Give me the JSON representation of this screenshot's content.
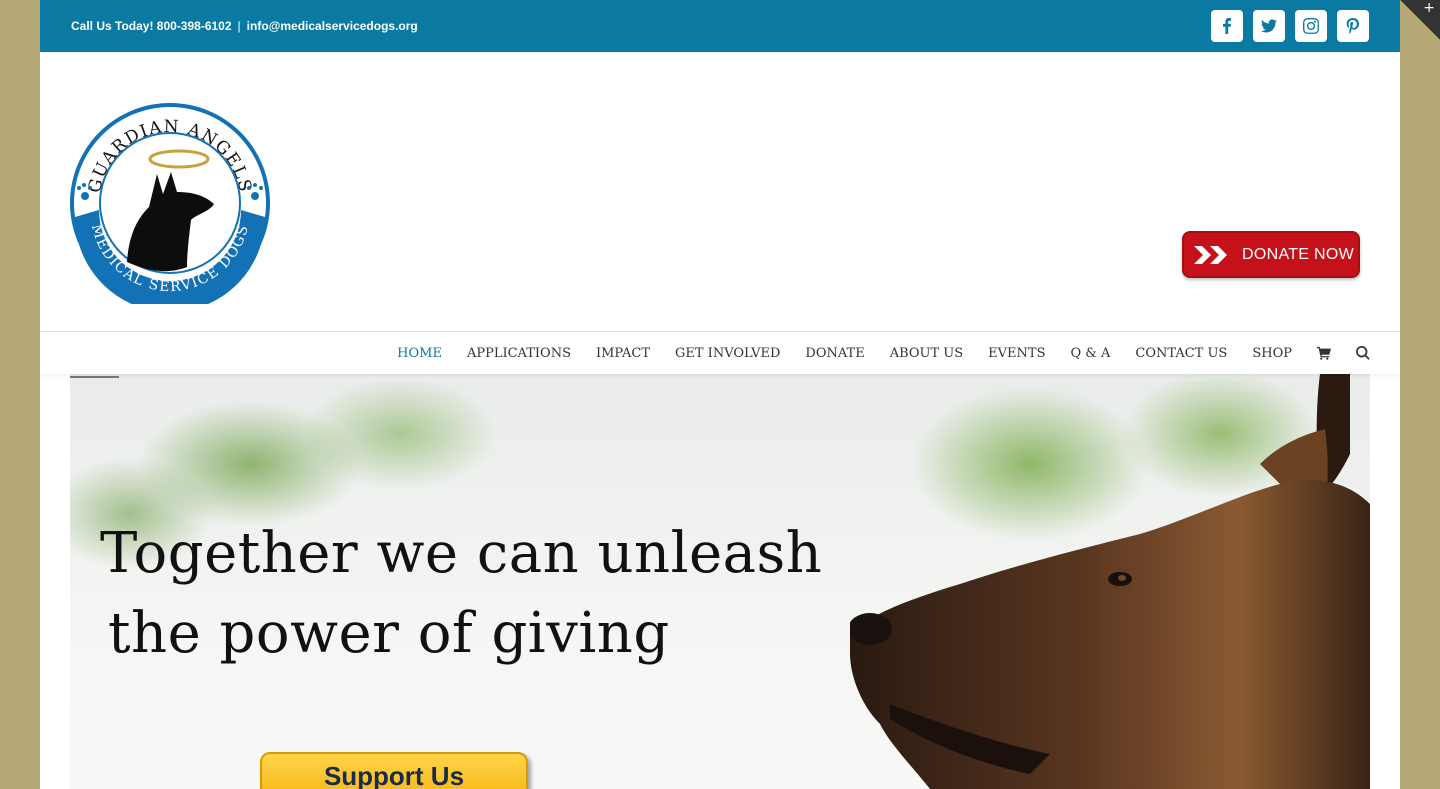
{
  "topbar": {
    "phone_text": "Call Us Today! 800-398-6102",
    "separator": "|",
    "email": "info@medicalservicedogs.org",
    "social": [
      {
        "name": "facebook-icon"
      },
      {
        "name": "twitter-icon"
      },
      {
        "name": "instagram-icon"
      },
      {
        "name": "pinterest-icon"
      }
    ]
  },
  "logo": {
    "top_text": "GUARDIAN ANGELS",
    "bottom_text": "MEDICAL SERVICE DOGS"
  },
  "header": {
    "donate_label": "DONATE NOW"
  },
  "nav": {
    "items": [
      "HOME",
      "APPLICATIONS",
      "IMPACT",
      "GET INVOLVED",
      "DONATE",
      "ABOUT US",
      "EVENTS",
      "Q & A",
      "CONTACT US",
      "SHOP"
    ],
    "active": "HOME",
    "icons": [
      "cart-icon",
      "search-icon"
    ]
  },
  "hero": {
    "title_line1": "Together we can unleash",
    "title_line2": "the power of giving",
    "button_label": "Support Us"
  },
  "corner": {
    "label": "+"
  },
  "colors": {
    "brand_blue": "#0b7aa3",
    "donate_red": "#c5121a",
    "support_yellow": "#f7b614",
    "frame_bg": "#b7a877"
  }
}
